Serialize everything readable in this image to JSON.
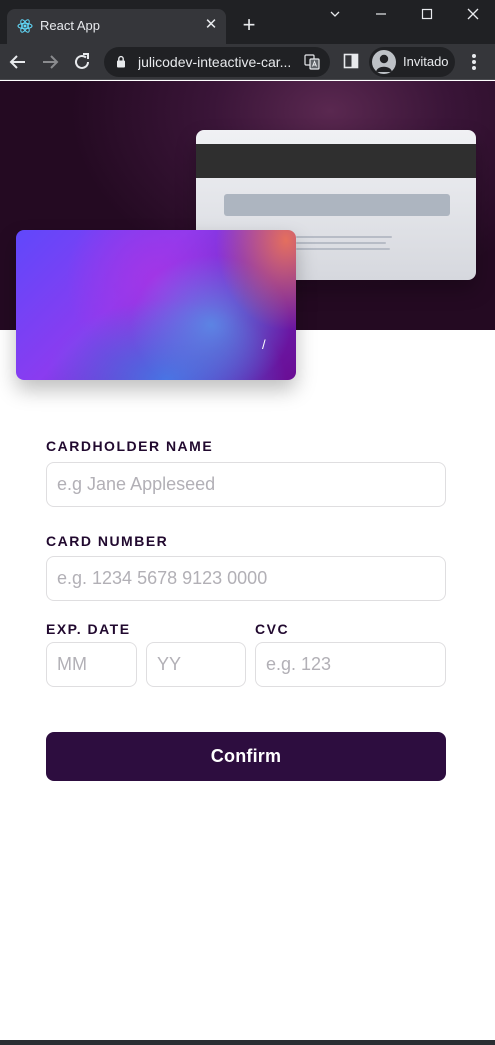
{
  "browser": {
    "tab_title": "React App",
    "url": "julicodev-inteactive-car...",
    "profile_label": "Invitado",
    "icons": [
      "react-favicon-icon",
      "tab-close-icon",
      "new-tab-icon",
      "minimize-icon",
      "maximize-icon",
      "close-window-icon",
      "back-arrow-icon",
      "forward-arrow-icon",
      "reload-icon",
      "lock-icon",
      "translate-icon",
      "side-panel-icon",
      "avatar-icon",
      "menu-icon"
    ]
  },
  "card_front": {
    "number": "",
    "name": "",
    "expiry_separator": "/"
  },
  "card_back": {
    "cvc": ""
  },
  "form": {
    "cardholder_label": "CARDHOLDER NAME",
    "cardholder_value": "",
    "cardholder_placeholder": "e.g Jane Appleseed",
    "number_label": "CARD NUMBER",
    "number_value": "",
    "number_placeholder": "e.g. 1234 5678 9123 0000",
    "exp_label": "EXP. DATE",
    "month_placeholder": "MM",
    "year_placeholder": "YY",
    "cvc_label": "CVC",
    "cvc_placeholder": "e.g. 123",
    "confirm_label": "Confirm"
  },
  "colors": {
    "primary_dark": "#2d0d3f",
    "input_border": "#dfdee0",
    "placeholder": "#b2b0b6",
    "label": "#21092f"
  }
}
